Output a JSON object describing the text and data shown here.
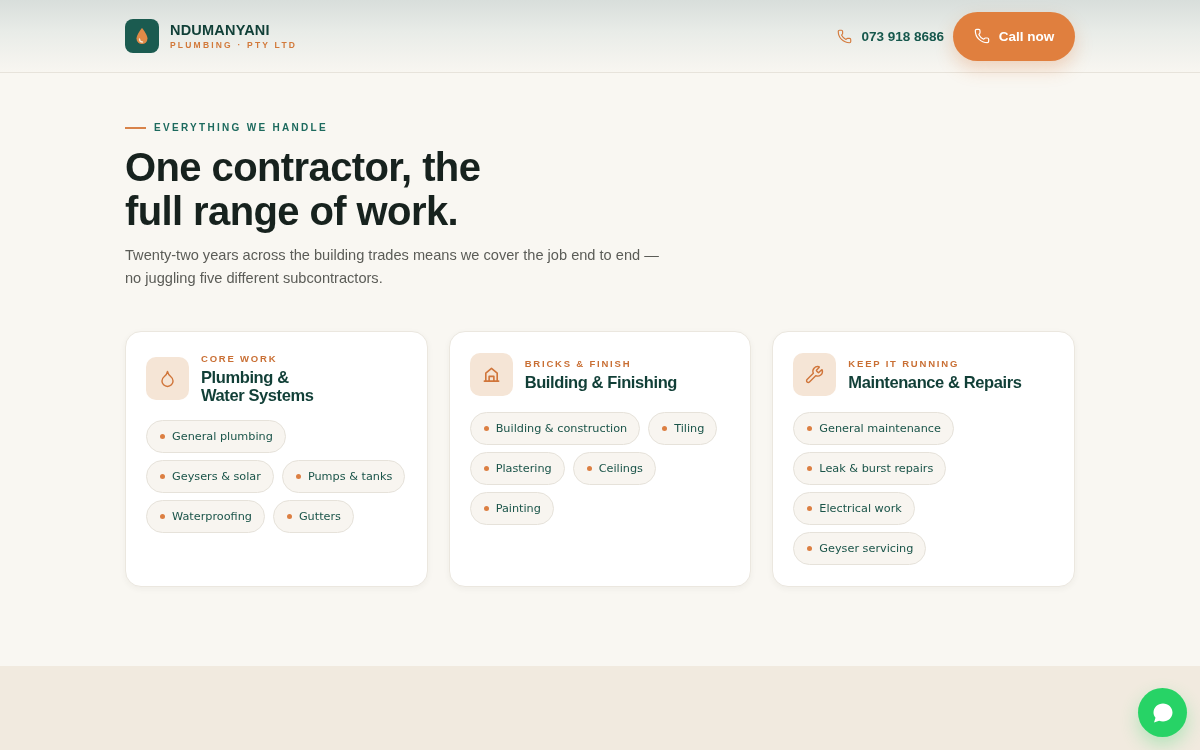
{
  "header": {
    "brand": {
      "name": "NDUMANYANI",
      "tagline": "PLUMBING · PTY LTD"
    },
    "phone": "073 918 8686",
    "call_button": "Call now"
  },
  "section": {
    "eyebrow": "EVERYTHING WE HANDLE",
    "heading": "One contractor, the full range of work.",
    "intro": "Twenty-two years across the building trades means we cover the job end to end — no juggling five different subcontractors."
  },
  "cards": [
    {
      "kind": "water",
      "eyebrow": "CORE WORK",
      "title": "Plumbing & Water Systems",
      "services": [
        "General plumbing",
        "Geysers & solar",
        "Pumps & tanks",
        "Waterproofing",
        "Gutters"
      ]
    },
    {
      "kind": "building",
      "eyebrow": "BRICKS & FINISH",
      "title": "Building & Finishing",
      "services": [
        "Building & construction",
        "Tiling",
        "Plastering",
        "Ceilings",
        "Painting"
      ]
    },
    {
      "kind": "maintenance",
      "eyebrow": "KEEP IT RUNNING",
      "title": "Maintenance & Repairs",
      "services": [
        "General maintenance",
        "Leak & burst repairs",
        "Electrical work",
        "Geyser servicing"
      ]
    }
  ]
}
